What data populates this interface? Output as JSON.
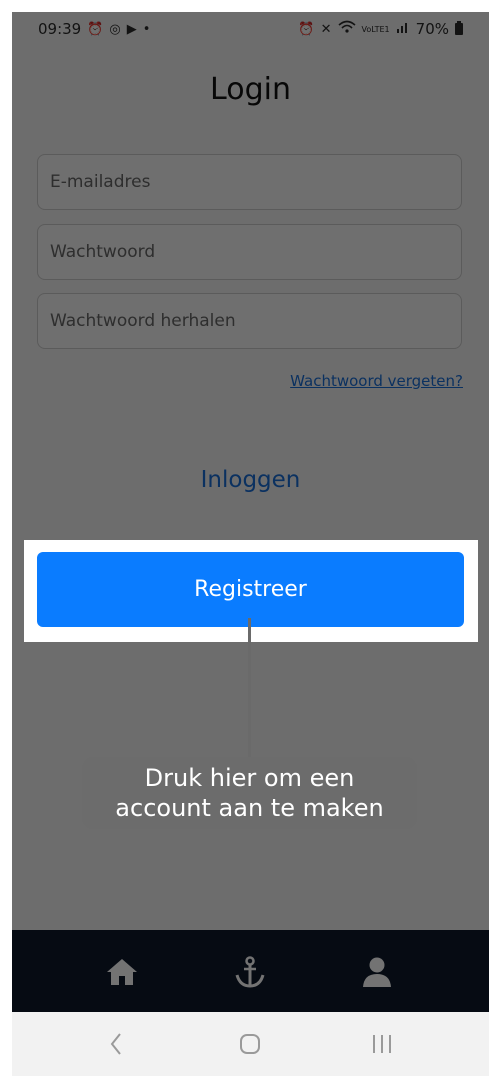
{
  "status_bar": {
    "time": "09:39",
    "battery": "70%",
    "left_icons": [
      "alarm-icon",
      "threads-icon",
      "play-icon",
      "dot-icon"
    ],
    "right_icons": [
      "alarm-icon",
      "mute-icon",
      "wifi-icon",
      "volte-icon",
      "signal-icon",
      "battery-icon"
    ],
    "volte_text": "VoLTE1"
  },
  "header": {
    "title": "Login"
  },
  "form": {
    "email_placeholder": "E-mailadres",
    "password_placeholder": "Wachtwoord",
    "password_repeat_placeholder": "Wachtwoord herhalen",
    "forgot_link": "Wachtwoord vergeten?",
    "login_label": "Inloggen",
    "register_label": "Registreer"
  },
  "tooltip": {
    "line1": "Druk hier om een",
    "line2": "account aan te maken"
  },
  "bottom_nav": {
    "items": [
      "home-icon",
      "anchor-icon",
      "user-icon"
    ]
  },
  "system_nav": {
    "items": [
      "back-icon",
      "home-circle-icon",
      "recents-icon"
    ]
  },
  "colors": {
    "accent": "#0a7cff",
    "link": "#1a6dd6",
    "nav_bg": "#0e1a2b",
    "overlay": "rgba(0,0,0,0.55)"
  }
}
